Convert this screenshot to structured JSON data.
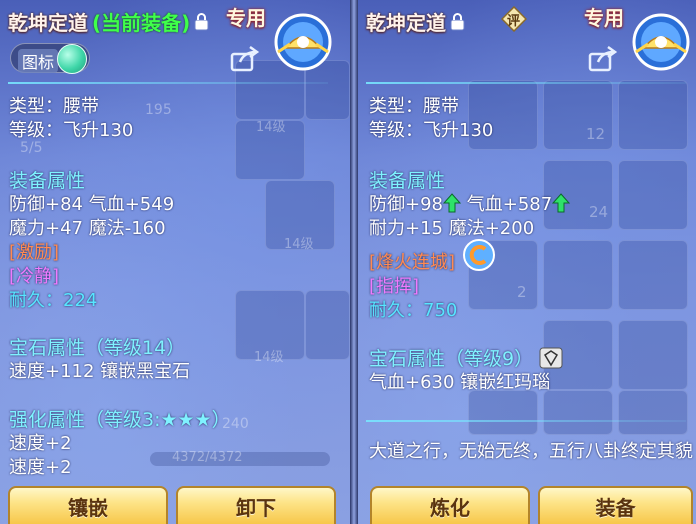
{
  "left_panel": {
    "title": "乾坤定道",
    "equipped_tag": "(当前装备)",
    "exclusive_label": "专用",
    "icon_toggle_label": "图标",
    "type_line": "类型：腰带",
    "level_line": "等级：飞升130",
    "equip_attr_header": "装备属性",
    "attr_line1": "防御+84 气血+549",
    "attr_line2": "魔力+47 魔法-160",
    "special_effect": "[激励]",
    "special_skill": "[冷静]",
    "durability": "耐久：224",
    "gem_header": "宝石属性（等级14）",
    "gem_line": "速度+112 镶嵌黑宝石",
    "strengthen_header": "强化属性（等级3:★★★）",
    "strengthen_line1": "速度+2",
    "strengthen_line2": "速度+2",
    "bg_hp_text": "4372/4372",
    "bg_inv_count": "14级",
    "bg_inv_count2": "14级",
    "bg_inv_count3": "14级",
    "bg_lv_text": "195",
    "bg_page_text": "5/5",
    "bg_stack_text": "240",
    "buttons": [
      "镶嵌",
      "卸下"
    ]
  },
  "right_panel": {
    "title": "乾坤定道",
    "review_badge": "评",
    "exclusive_label": "专用",
    "type_line": "类型：腰带",
    "level_line": "等级：飞升130",
    "equip_attr_header": "装备属性",
    "attr_line1_a": "防御+98",
    "attr_line1_b": "气血+587",
    "attr_line2": "耐力+15 魔法+200",
    "special_effect": "[烽火连城]",
    "special_skill": "[指挥]",
    "durability": "耐久：750",
    "gem_header": "宝石属性（等级9）",
    "gem_line": "气血+630 镶嵌红玛瑙",
    "description": "大道之行，无始无终，五行八卦终定其貌",
    "bg_num1": "12",
    "bg_num2": "24",
    "bg_num3": "2",
    "buttons": [
      "炼化",
      "装备"
    ]
  },
  "colors": {
    "header_cyan": "#7ff2ff",
    "equipped_green": "#3fff4a",
    "effect_orange": "#ff8a52",
    "skill_purple": "#f07aff",
    "durability_cyan": "#57e6ff",
    "button_gold": "#f7c74a"
  },
  "icons": [
    "lock-icon",
    "emblem-icon",
    "share-icon",
    "toggle-knob-icon",
    "up-arrow-icon",
    "refine-icon",
    "gem-icon",
    "review-badge-icon"
  ]
}
